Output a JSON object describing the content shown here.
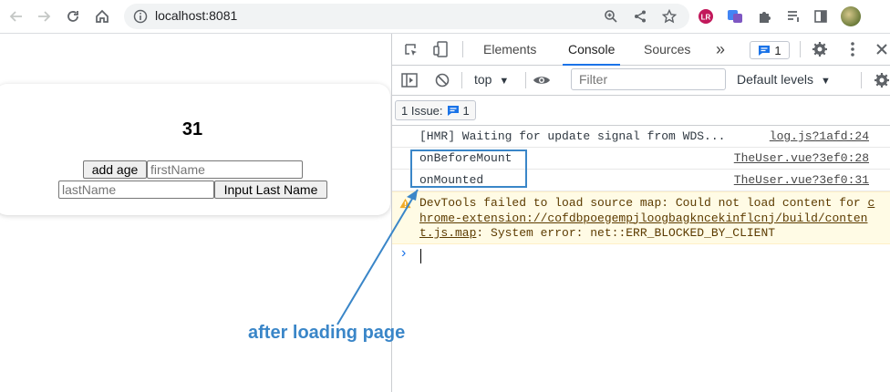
{
  "browser": {
    "url": "localhost:8081",
    "icons": [
      "back-icon",
      "forward-icon",
      "reload-icon",
      "home-icon",
      "info-icon",
      "zoom-icon",
      "share-icon",
      "bookmark-star-icon",
      "extension-icons",
      "puzzle-icon",
      "tab-search-icon",
      "side-panel-icon",
      "profile-avatar"
    ]
  },
  "app": {
    "age": "31",
    "add_age_label": "add age",
    "first_name_placeholder": "firstName",
    "last_name_placeholder": "lastName",
    "input_last_name_label": "Input Last Name"
  },
  "annotation": {
    "text": "after loading page",
    "color": "#3a86c8"
  },
  "devtools": {
    "tabs": [
      "Elements",
      "Console",
      "Sources"
    ],
    "active_tab": "Console",
    "more_tabs": "»",
    "issues_badge_count": "1",
    "context": "top",
    "filter_placeholder": "Filter",
    "levels": "Default levels",
    "issues_label": "1 Issue:",
    "issues_count": "1",
    "logs": [
      {
        "message": "[HMR] Waiting for update signal from WDS...",
        "source": "log.js?1afd:24"
      },
      {
        "message": "onBeforeMount",
        "source": "TheUser.vue?3ef0:28"
      },
      {
        "message": "onMounted",
        "source": "TheUser.vue?3ef0:31"
      }
    ],
    "warning": {
      "prefix": "DevTools failed to load source map: Could not load content for ",
      "link": "chrome-extension://cofdbpoegempjloogbagkncekinflcnj/build/content.js.map",
      "suffix": ": System error: net::ERR_BLOCKED_BY_CLIENT"
    },
    "prompt": "›"
  }
}
